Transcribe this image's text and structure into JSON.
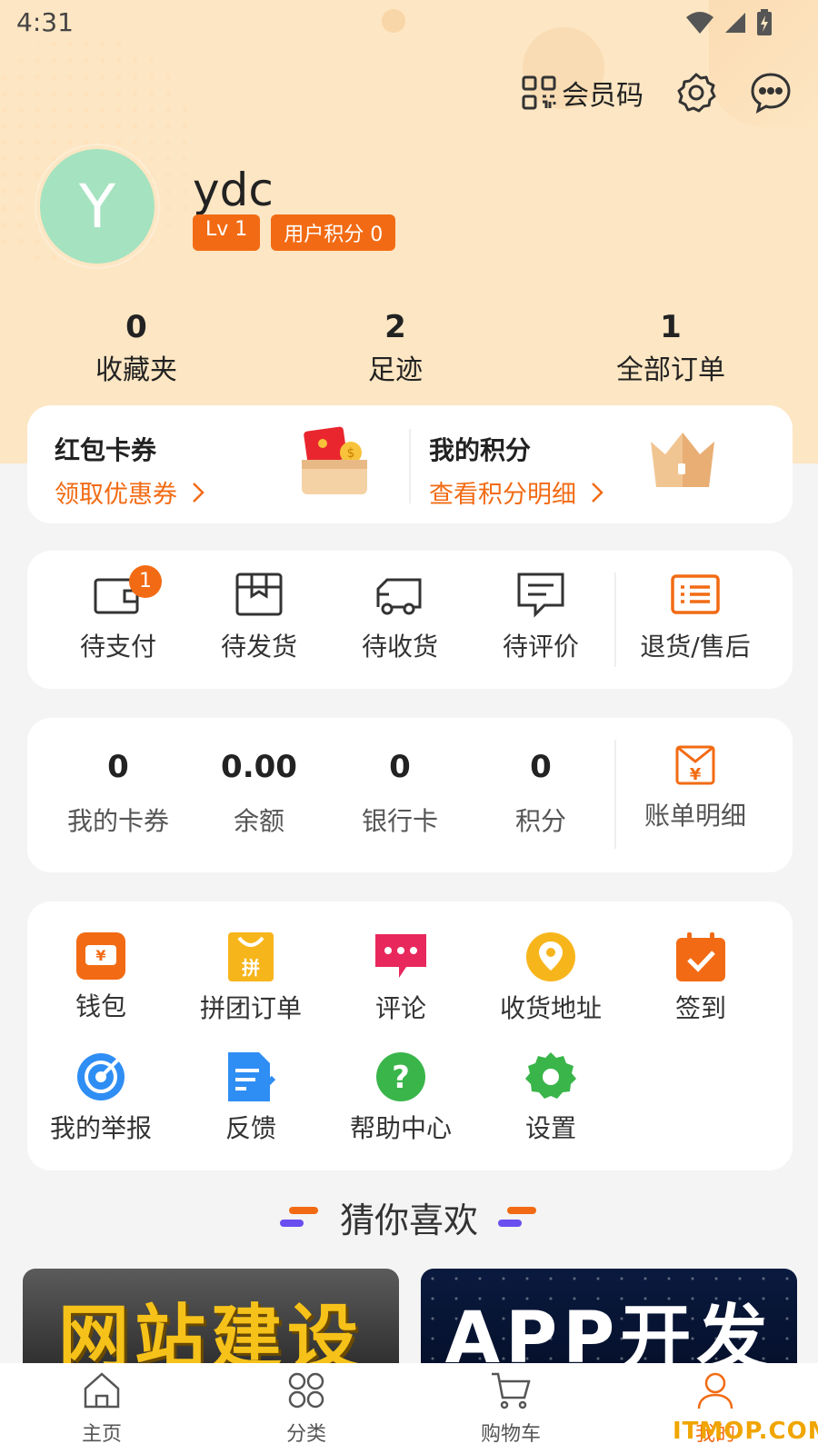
{
  "status_bar": {
    "time": "4:31"
  },
  "header": {
    "member_code_label": "会员码"
  },
  "profile": {
    "avatar_letter": "Y",
    "username": "ydc",
    "level": "Lv 1",
    "points_badge": "用户积分 0"
  },
  "stats": [
    {
      "value": "0",
      "label": "收藏夹"
    },
    {
      "value": "2",
      "label": "足迹"
    },
    {
      "value": "1",
      "label": "全部订单"
    }
  ],
  "promo": {
    "left": {
      "title": "红包卡券",
      "subtitle": "领取优惠券"
    },
    "right": {
      "title": "我的积分",
      "subtitle": "查看积分明细"
    }
  },
  "orders": {
    "items": [
      {
        "label": "待支付",
        "badge": "1"
      },
      {
        "label": "待发货"
      },
      {
        "label": "待收货"
      },
      {
        "label": "待评价"
      },
      {
        "label": "退货/售后"
      }
    ]
  },
  "wallet": {
    "items": [
      {
        "value": "0",
        "label": "我的卡券"
      },
      {
        "value": "0.00",
        "label": "余额"
      },
      {
        "value": "0",
        "label": "银行卡"
      },
      {
        "value": "0",
        "label": "积分"
      }
    ],
    "bill_label": "账单明细"
  },
  "services": [
    {
      "label": "钱包"
    },
    {
      "label": "拼团订单"
    },
    {
      "label": "评论"
    },
    {
      "label": "收货地址"
    },
    {
      "label": "签到"
    },
    {
      "label": "我的举报"
    },
    {
      "label": "反馈"
    },
    {
      "label": "帮助中心"
    },
    {
      "label": "设置"
    }
  ],
  "recommend": {
    "title": "猜你喜欢",
    "banners": [
      {
        "text": "网站建设"
      },
      {
        "text": "APP开发"
      }
    ]
  },
  "tabbar": {
    "items": [
      {
        "label": "主页"
      },
      {
        "label": "分类"
      },
      {
        "label": "购物车"
      },
      {
        "label": "我的"
      }
    ]
  },
  "watermark": "ITMOP.COM",
  "colors": {
    "accent": "#f26b14",
    "hero_bg": "#fde6c3",
    "avatar": "#a5e2c0"
  }
}
